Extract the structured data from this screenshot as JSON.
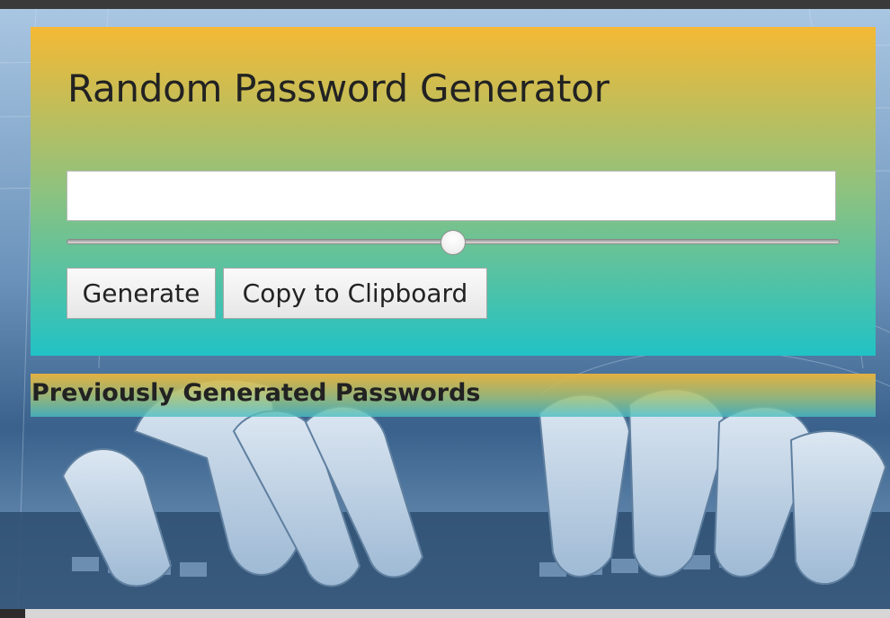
{
  "app": {
    "title": "Random Password Generator"
  },
  "password_field": {
    "value": "",
    "placeholder": ""
  },
  "length_slider": {
    "level_percent": 50
  },
  "buttons": {
    "generate_label": "Generate",
    "copy_label": "Copy to Clipboard"
  },
  "history": {
    "heading": "Previously Generated Passwords",
    "items": []
  },
  "colors": {
    "card_gradient_top": "#f4b935",
    "card_gradient_bottom": "#21c2c5",
    "text": "#222222"
  }
}
